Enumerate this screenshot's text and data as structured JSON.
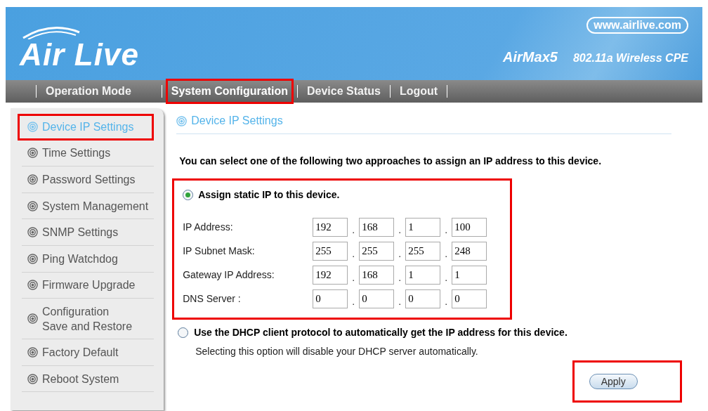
{
  "header": {
    "logo": "Air Live",
    "website": "www.airlive.com",
    "model": "AirMax5",
    "product": "802.11a Wireless CPE"
  },
  "nav": [
    {
      "label": "Operation Mode",
      "selected": false,
      "highlighted": false
    },
    {
      "label": "System Configuration",
      "selected": true,
      "highlighted": true
    },
    {
      "label": "Device Status",
      "selected": false,
      "highlighted": false
    },
    {
      "label": "Logout",
      "selected": false,
      "highlighted": false
    }
  ],
  "sidebar": {
    "items": [
      {
        "label": "Device IP Settings",
        "selected": true,
        "highlighted": true
      },
      {
        "label": "Time Settings",
        "selected": false,
        "highlighted": false
      },
      {
        "label": "Password Settings",
        "selected": false,
        "highlighted": false
      },
      {
        "label": "System Management",
        "selected": false,
        "highlighted": false
      },
      {
        "label": "SNMP Settings",
        "selected": false,
        "highlighted": false
      },
      {
        "label": "Ping Watchdog",
        "selected": false,
        "highlighted": false
      },
      {
        "label": "Firmware Upgrade",
        "selected": false,
        "highlighted": false
      },
      {
        "label": "Configuration\nSave and Restore",
        "selected": false,
        "highlighted": false
      },
      {
        "label": "Factory Default",
        "selected": false,
        "highlighted": false
      },
      {
        "label": "Reboot System",
        "selected": false,
        "highlighted": false
      }
    ]
  },
  "content": {
    "title": "Device IP Settings",
    "intro": "You can select one of the following two approaches to assign an IP address to this device.",
    "static_option": {
      "label": "Assign static IP to this device.",
      "selected": true,
      "highlighted": true,
      "separator": ".",
      "fields": [
        {
          "label": "IP Address:",
          "octets": [
            "192",
            "168",
            "1",
            "100"
          ]
        },
        {
          "label": "IP Subnet Mask:",
          "octets": [
            "255",
            "255",
            "255",
            "248"
          ]
        },
        {
          "label": "Gateway IP Address:",
          "octets": [
            "192",
            "168",
            "1",
            "1"
          ]
        },
        {
          "label": "DNS Server :",
          "octets": [
            "0",
            "0",
            "0",
            "0"
          ]
        }
      ]
    },
    "dhcp_option": {
      "label": "Use the DHCP client protocol to automatically get the IP address for this device.",
      "selected": false,
      "note": "Selecting this option will disable your DHCP server automatically."
    },
    "apply": {
      "label": "Apply",
      "highlighted": true
    }
  }
}
